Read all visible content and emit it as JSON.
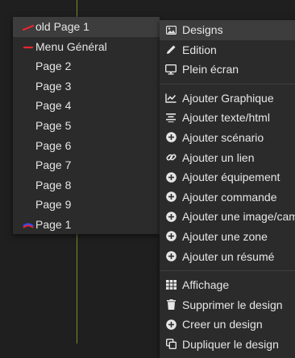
{
  "pages_menu": {
    "items": [
      {
        "label": "old Page 1",
        "mark": "red-dash"
      },
      {
        "label": "Menu Général",
        "mark": "red-dash"
      },
      {
        "label": "Page 2",
        "mark": ""
      },
      {
        "label": "Page 3",
        "mark": ""
      },
      {
        "label": "Page 4",
        "mark": ""
      },
      {
        "label": "Page 5",
        "mark": ""
      },
      {
        "label": "Page 6",
        "mark": ""
      },
      {
        "label": "Page 7",
        "mark": ""
      },
      {
        "label": "Page 8",
        "mark": ""
      },
      {
        "label": "Page 9",
        "mark": ""
      },
      {
        "label": "Page 1",
        "mark": "blue-red-arc"
      }
    ]
  },
  "context_menu": {
    "group1": [
      {
        "label": "Designs",
        "icon": "image-icon"
      },
      {
        "label": "Edition",
        "icon": "pencil-icon"
      },
      {
        "label": "Plein écran",
        "icon": "monitor-icon"
      }
    ],
    "group2": [
      {
        "label": "Ajouter Graphique",
        "icon": "line-chart-icon"
      },
      {
        "label": "Ajouter texte/html",
        "icon": "align-center-icon"
      },
      {
        "label": "Ajouter scénario",
        "icon": "plus-circle-icon"
      },
      {
        "label": "Ajouter un lien",
        "icon": "link-icon"
      },
      {
        "label": "Ajouter équipement",
        "icon": "plus-circle-icon"
      },
      {
        "label": "Ajouter commande",
        "icon": "plus-circle-icon"
      },
      {
        "label": "Ajouter une image/cam",
        "icon": "plus-circle-icon"
      },
      {
        "label": "Ajouter une zone",
        "icon": "plus-circle-icon"
      },
      {
        "label": "Ajouter un résumé",
        "icon": "plus-circle-icon"
      }
    ],
    "group3": [
      {
        "label": "Affichage",
        "icon": "grid-icon"
      },
      {
        "label": "Supprimer le design",
        "icon": "trash-icon"
      },
      {
        "label": "Creer un design",
        "icon": "plus-circle-icon"
      },
      {
        "label": "Dupliquer le design",
        "icon": "copy-icon"
      }
    ]
  },
  "colors": {
    "background": "#1f1f1f",
    "menu_bg": "#2b2b2b",
    "active_bg": "#3d3d3d",
    "text": "#e6e6e6",
    "guide_line": "#7f8a2a",
    "mark_red": "#e8262d",
    "mark_blue": "#3b4cff"
  }
}
